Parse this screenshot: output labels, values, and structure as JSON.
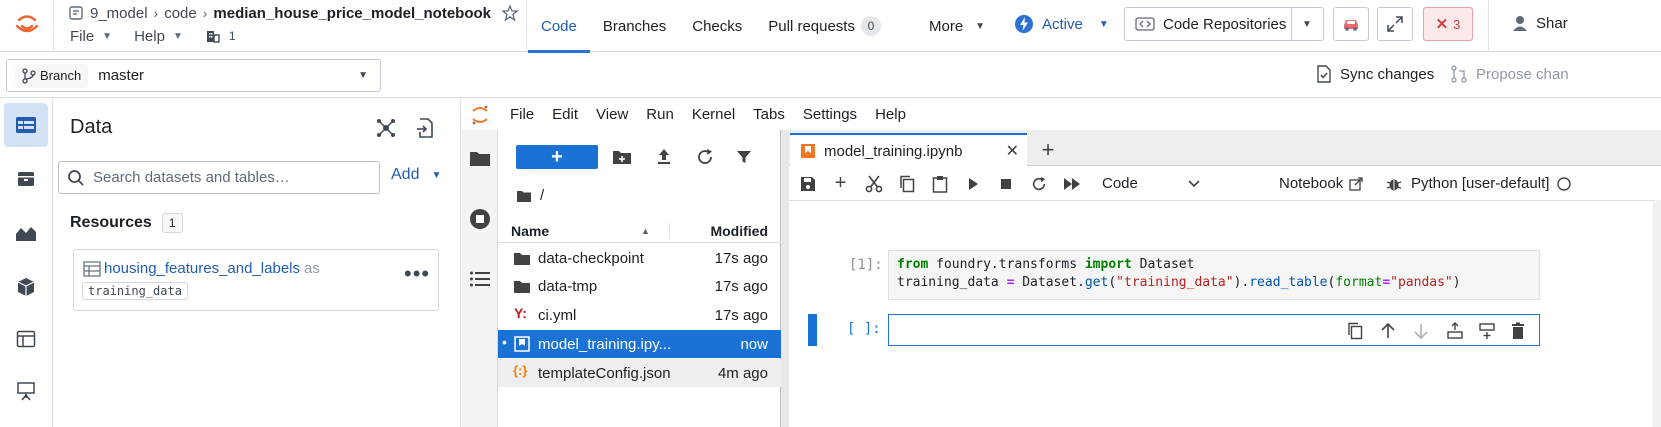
{
  "header": {
    "breadcrumbs": [
      "9_model",
      "code"
    ],
    "current": "median_house_price_model_notebook",
    "menu": [
      "File",
      "Help"
    ],
    "org_count": "1",
    "tabs": [
      {
        "label": "Code",
        "active": true
      },
      {
        "label": "Branches"
      },
      {
        "label": "Checks"
      },
      {
        "label": "Pull requests",
        "badge": "0"
      },
      {
        "label": "More"
      }
    ],
    "status": "Active",
    "repositories_label": "Code Repositories",
    "error_count": "3",
    "user_short": "Shar",
    "colors": {
      "accent": "#2d72d2",
      "error": "#cd4246"
    }
  },
  "branch": {
    "pill": "Branch",
    "value": "master",
    "sync": "Sync changes",
    "propose": "Propose chan"
  },
  "data_panel": {
    "title": "Data",
    "search_placeholder": "Search datasets and tables…",
    "add": "Add",
    "resources_label": "Resources",
    "resources_count": "1",
    "resource": {
      "name": "housing_features_and_labels",
      "as": "as",
      "alias": "training_data"
    }
  },
  "jupyter": {
    "menu": [
      "File",
      "Edit",
      "View",
      "Run",
      "Kernel",
      "Tabs",
      "Settings",
      "Help"
    ],
    "file_browser": {
      "path": "/",
      "columns": {
        "name": "Name",
        "modified": "Modified"
      },
      "files": [
        {
          "name": "data-checkpoint",
          "modified": "17s ago",
          "type": "folder"
        },
        {
          "name": "data-tmp",
          "modified": "17s ago",
          "type": "folder"
        },
        {
          "name": "ci.yml",
          "modified": "17s ago",
          "type": "yaml"
        },
        {
          "name": "model_training.ipy...",
          "modified": "now",
          "type": "notebook",
          "selected": true
        },
        {
          "name": "templateConfig.json",
          "modified": "4m ago",
          "type": "json"
        }
      ]
    },
    "notebook": {
      "tab_title": "model_training.ipynb",
      "cell_type": "Code",
      "notebook_label": "Notebook",
      "kernel": "Python [user-default]",
      "cells": [
        {
          "prompt": "[1]:",
          "line1": {
            "kw1": "from",
            "mod": " foundry.transforms ",
            "kw2": "import",
            "rest": " Dataset"
          },
          "line2": {
            "a": "training_data ",
            "eq": "=",
            "b": " Dataset.",
            "fn1": "get",
            "c": "(",
            "s1": "\"training_data\"",
            "d": ").",
            "fn2": "read_table",
            "e": "(",
            "arg": "format",
            "eq2": "=",
            "s2": "\"pandas\"",
            "f": ")"
          }
        },
        {
          "prompt": "[ ]:"
        }
      ]
    }
  }
}
